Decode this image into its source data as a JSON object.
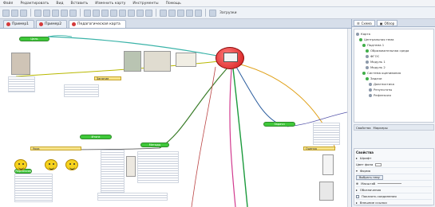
{
  "menu": [
    "Файл",
    "Редактировать",
    "Вид",
    "Вставить",
    "Изменить карту",
    "Инструменты",
    "Помощь"
  ],
  "toolbar": {
    "label": "Загрузки"
  },
  "tabs": [
    {
      "label": "Пример1",
      "active": false
    },
    {
      "label": "Пример2",
      "active": false
    },
    {
      "label": "Педагогическая карта",
      "active": true
    }
  ],
  "right_panel": {
    "tabs": [
      "Схема",
      "Обзор"
    ],
    "tree": [
      {
        "label": "Карта",
        "level": 0
      },
      {
        "label": "Центральная тема",
        "level": 1
      },
      {
        "label": "Подтема 1",
        "level": 2
      },
      {
        "label": "Образовательная среда",
        "level": 3
      },
      {
        "label": "ФГОС",
        "level": 3
      },
      {
        "label": "Модуль 1",
        "level": 3
      },
      {
        "label": "Модуль 2",
        "level": 3
      },
      {
        "label": "Система оценивания",
        "level": 2
      },
      {
        "label": "Задачи",
        "level": 3
      },
      {
        "label": "Диагностика",
        "level": 4
      },
      {
        "label": "Результаты",
        "level": 4
      },
      {
        "label": "Рефлексия",
        "level": 4
      }
    ],
    "bar_items": [
      "Свойства",
      "Маркеры"
    ],
    "props_title": "Свойства",
    "props": [
      {
        "label": "Шрифт",
        "kind": "expand"
      },
      {
        "label": "Цвет фона",
        "kind": "swatch"
      },
      {
        "label": "Форма",
        "kind": "expand"
      },
      {
        "label": "Выбрать тему",
        "kind": "button"
      },
      {
        "label": "Масштаб",
        "kind": "slider"
      },
      {
        "label": "Обозначения",
        "kind": "expand"
      },
      {
        "label": "Показать соединения",
        "kind": "check"
      },
      {
        "label": "Внешние ссылки",
        "kind": "expand"
      }
    ]
  },
  "map": {
    "green_topics": [
      "Цель",
      "Задачи",
      "Итоги",
      "Методы",
      "Рефлексия"
    ],
    "yellow_labels": [
      "Занятие",
      "Урок",
      "Оценка"
    ]
  }
}
